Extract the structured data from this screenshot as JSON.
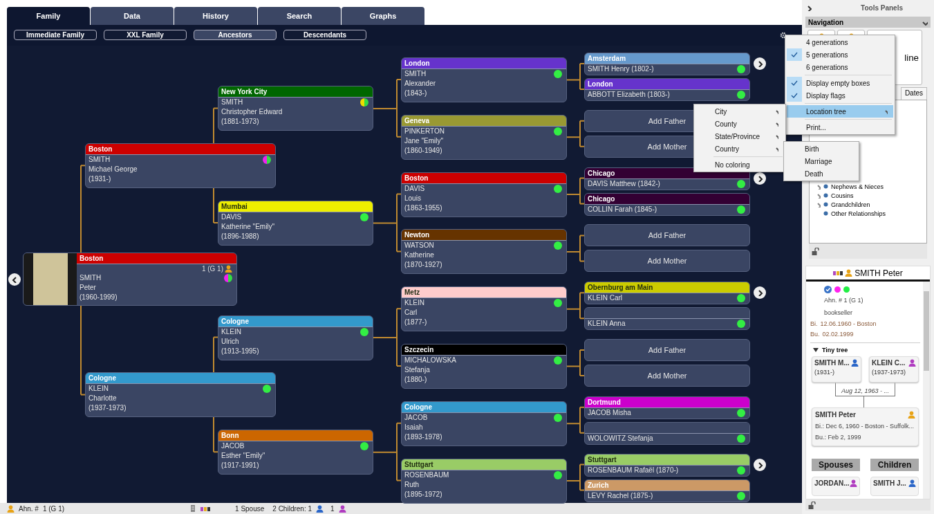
{
  "tabs": [
    {
      "label": "Family",
      "selected": true
    },
    {
      "label": "Data",
      "selected": false
    },
    {
      "label": "History",
      "selected": false
    },
    {
      "label": "Search",
      "selected": false
    },
    {
      "label": "Graphs",
      "selected": false
    }
  ],
  "views": [
    {
      "label": "Immediate Family",
      "selected": false
    },
    {
      "label": "XXL Family",
      "selected": false
    },
    {
      "label": "Ancestors",
      "selected": true
    },
    {
      "label": "Descendants",
      "selected": false
    }
  ],
  "back_button": true,
  "tree": {
    "location": "Boston",
    "color": "#cc0000",
    "photo": true,
    "badge": "1 (G 1)",
    "surname": "SMITH",
    "given": "Peter",
    "years": "(1960-1999)",
    "dots": [
      {
        "color": "#ee22ee"
      },
      {
        "color": "#33dd44"
      }
    ],
    "parents": [
      {
        "location": "Boston",
        "color": "#cc0000",
        "surname": "SMITH",
        "given": "Michael George",
        "years": "(1931-)",
        "dots": [
          {
            "color": "#ee22ee"
          },
          {
            "color": "#33dd44"
          }
        ],
        "parents": [
          {
            "location": "New York City",
            "color": "#006600",
            "surname": "SMITH",
            "given": "Christopher Edward",
            "years": "(1881-1973)",
            "dots": [
              {
                "color": "#eedd00"
              },
              {
                "color": "#33dd44"
              }
            ],
            "parents": [
              {
                "location": "London",
                "color": "#6633cc",
                "surname": "SMITH",
                "given": "Alexander",
                "years": "(1843-)",
                "dots": [
                  {
                    "color": "#33ee44"
                  }
                ],
                "more": true,
                "parents": [
                  {
                    "kind": "person",
                    "location": "Amsterdam",
                    "color": "#6699cc",
                    "name": "SMITH Henry (1802-)",
                    "dots": [
                      {
                        "color": "#33ee44"
                      }
                    ]
                  },
                  {
                    "kind": "person",
                    "location": "London",
                    "color": "#6633cc",
                    "name": "ABBOTT Elizabeth (1803-)",
                    "dots": [
                      {
                        "color": "#33ee44"
                      }
                    ]
                  }
                ]
              },
              {
                "location": "Geneva",
                "color": "#999933",
                "surname": "PINKERTON",
                "given": "Jane \"Emily\"",
                "years": "(1860-1949)",
                "dots": [
                  {
                    "color": "#33ee44"
                  }
                ],
                "parents": [
                  {
                    "kind": "add",
                    "label": "Add Father"
                  },
                  {
                    "kind": "add",
                    "label": "Add Mother"
                  }
                ]
              }
            ]
          },
          {
            "location": "Mumbai",
            "color": "#eeee00",
            "surname": "DAVIS",
            "given": "Katherine \"Emily\"",
            "years": "(1896-1988)",
            "dots": [
              {
                "color": "#33ee44"
              }
            ],
            "parents": [
              {
                "location": "Boston",
                "color": "#cc0000",
                "surname": "DAVIS",
                "given": "Louis",
                "years": "(1863-1955)",
                "dots": [
                  {
                    "color": "#33ee44"
                  }
                ],
                "more": true,
                "parents": [
                  {
                    "kind": "person",
                    "location": "Chicago",
                    "color": "#330033",
                    "name": "DAVIS Matthew (1842-)",
                    "dots": [
                      {
                        "color": "#33ee44"
                      }
                    ]
                  },
                  {
                    "kind": "person",
                    "location": "Chicago",
                    "color": "#330033",
                    "name": "COLLIN Farah (1845-)",
                    "dots": [
                      {
                        "color": "#33ee44"
                      }
                    ]
                  }
                ]
              },
              {
                "location": "Newton",
                "color": "#663300",
                "surname": "WATSON",
                "given": "Katherine",
                "years": "(1870-1927)",
                "dots": [
                  {
                    "color": "#33ee44"
                  }
                ],
                "more": false,
                "parents": [
                  {
                    "kind": "add",
                    "label": "Add Father"
                  },
                  {
                    "kind": "add",
                    "label": "Add Mother"
                  }
                ]
              }
            ]
          }
        ]
      },
      {
        "location": "Cologne",
        "color": "#3399cc",
        "surname": "KLEIN",
        "given": "Charlotte",
        "years": "(1937-1973)",
        "dots": [
          {
            "color": "#33ee44"
          }
        ],
        "parents": [
          {
            "location": "Cologne",
            "color": "#3399cc",
            "surname": "KLEIN",
            "given": "Ulrich",
            "years": "(1913-1995)",
            "dots": [
              {
                "color": "#33ee44"
              }
            ],
            "parents": [
              {
                "location": "Metz",
                "color": "#ffcccc",
                "surname": "KLEIN",
                "given": "Carl",
                "years": "(1877-)",
                "dots": [
                  {
                    "color": "#33ee44"
                  }
                ],
                "more": true,
                "parents": [
                  {
                    "kind": "person",
                    "location": "Obernburg am Main",
                    "color": "#cccc00",
                    "name": "KLEIN Carl",
                    "dots": [
                      {
                        "color": "#33ee44"
                      }
                    ]
                  },
                  {
                    "kind": "person",
                    "name": "KLEIN Anna",
                    "dots": [
                      {
                        "color": "#33ee44"
                      }
                    ]
                  }
                ]
              },
              {
                "location": "Szczecin",
                "color": "#000000",
                "surname": "MICHALOWSKA",
                "given": "Stefanja",
                "years": "(1880-)",
                "dots": [
                  {
                    "color": "#33ee44"
                  }
                ],
                "more": false,
                "parents": [
                  {
                    "kind": "add",
                    "label": "Add Father"
                  },
                  {
                    "kind": "add",
                    "label": "Add Mother"
                  }
                ]
              }
            ]
          },
          {
            "location": "Bonn",
            "color": "#cc6600",
            "surname": "JACOB",
            "given": "Esther \"Emily\"",
            "years": "(1917-1991)",
            "dots": [
              {
                "color": "#33ee44"
              }
            ],
            "parents": [
              {
                "location": "Cologne",
                "color": "#3399cc",
                "surname": "JACOB",
                "given": "Isaiah",
                "years": "(1893-1978)",
                "dots": [
                  {
                    "color": "#33ee44"
                  }
                ],
                "more": false,
                "parents": [
                  {
                    "kind": "person",
                    "location": "Dortmund",
                    "color": "#cc00cc",
                    "name": "JACOB Misha",
                    "dots": [
                      {
                        "color": "#33ee44"
                      }
                    ]
                  },
                  {
                    "kind": "person",
                    "name": "WOLOWITZ Stefanja",
                    "dots": [
                      {
                        "color": "#33ee44"
                      }
                    ]
                  }
                ]
              },
              {
                "location": "Stuttgart",
                "color": "#99cc66",
                "surname": "ROSENBAUM",
                "given": "Ruth",
                "years": "(1895-1972)",
                "dots": [
                  {
                    "color": "#33ee44"
                  }
                ],
                "more": true,
                "parents": [
                  {
                    "kind": "person",
                    "location": "Stuttgart",
                    "color": "#99cc66",
                    "name": "ROSENBAUM Rafaël (1870-)",
                    "dots": [
                      {
                        "color": "#33ee44"
                      }
                    ]
                  },
                  {
                    "kind": "person",
                    "location": "Zurich",
                    "color": "#cc9966",
                    "name": "LEVY Rachel (1875-)",
                    "dots": [
                      {
                        "color": "#33ee44"
                      }
                    ]
                  }
                ]
              }
            ]
          }
        ]
      }
    ]
  },
  "status_bar": {
    "ahn_label": "Ahn. #",
    "ahn_value": "1 (G 1)",
    "spouses": "1 Spouse",
    "children": "2 Children: 1",
    "daughters": "1"
  },
  "tools_panel": {
    "title": "Tools Panels",
    "section": "Navigation",
    "nav_label": "line",
    "tab": "Dates",
    "relations": [
      {
        "label": "Nephews & Nieces",
        "expandable": true
      },
      {
        "label": "Cousins",
        "expandable": true
      },
      {
        "label": "Grandchildren",
        "expandable": true
      },
      {
        "label": "Other Relationships",
        "expandable": false
      }
    ]
  },
  "person_panel": {
    "name": "SMITH Peter",
    "dots": [
      {
        "color": "#ff22ee"
      },
      {
        "color": "#22ee44"
      }
    ],
    "ahn": "Ahn. # 1 (G 1)",
    "occupation": "bookseller",
    "facts": [
      {
        "label": "Bi.",
        "value": "12.06.1960 - Boston"
      },
      {
        "label": "Bu.",
        "value": "02.02.1999"
      }
    ],
    "section": "Tiny tree",
    "expanded": true,
    "tiny_parents": [
      {
        "name": "SMITH M...",
        "years": "(1931-)",
        "kind": "male"
      },
      {
        "name": "KLEIN C...",
        "years": "(1937-1973)",
        "kind": "female"
      }
    ],
    "marriage": "Aug 12, 1963 - ...",
    "tiny_person": {
      "name": "SMITH Peter",
      "kind": "self",
      "lines": [
        "Bi.: Dec 6, 1960 - Boston - Suffolk...",
        "Bu.: Feb 2, 1999"
      ]
    },
    "buttons": [
      "Spouses",
      "Children"
    ],
    "relatives": [
      {
        "name": "JORDAN...",
        "kind": "female"
      },
      {
        "name": "SMITH J...",
        "kind": "male"
      }
    ]
  },
  "menu": [
    {
      "kind": "item",
      "label": "4 generations",
      "checked": false,
      "highlighted": false
    },
    {
      "kind": "item",
      "label": "5 generations",
      "checked": true,
      "highlighted": false
    },
    {
      "kind": "item",
      "label": "6 generations",
      "checked": false,
      "highlighted": false
    },
    {
      "kind": "separator"
    },
    {
      "kind": "item",
      "label": "Display empty boxes",
      "checked": true,
      "highlighted": false
    },
    {
      "kind": "item",
      "label": "Display flags",
      "checked": true,
      "highlighted": false
    },
    {
      "kind": "separator"
    },
    {
      "kind": "submenu",
      "label": "Location tree",
      "checked": false,
      "highlighted": true
    },
    {
      "kind": "separator"
    },
    {
      "kind": "item",
      "label": "Print...",
      "checked": false,
      "highlighted": false
    }
  ],
  "submenu": [
    {
      "kind": "submenu",
      "label": "City"
    },
    {
      "kind": "submenu",
      "label": "County"
    },
    {
      "kind": "submenu",
      "label": "State/Province"
    },
    {
      "kind": "submenu",
      "label": "Country"
    },
    {
      "kind": "separator"
    },
    {
      "kind": "item",
      "label": "No coloring"
    }
  ],
  "submenu2": [
    {
      "kind": "item",
      "label": "Birth"
    },
    {
      "kind": "item",
      "label": "Marriage"
    },
    {
      "kind": "item",
      "label": "Death"
    }
  ]
}
